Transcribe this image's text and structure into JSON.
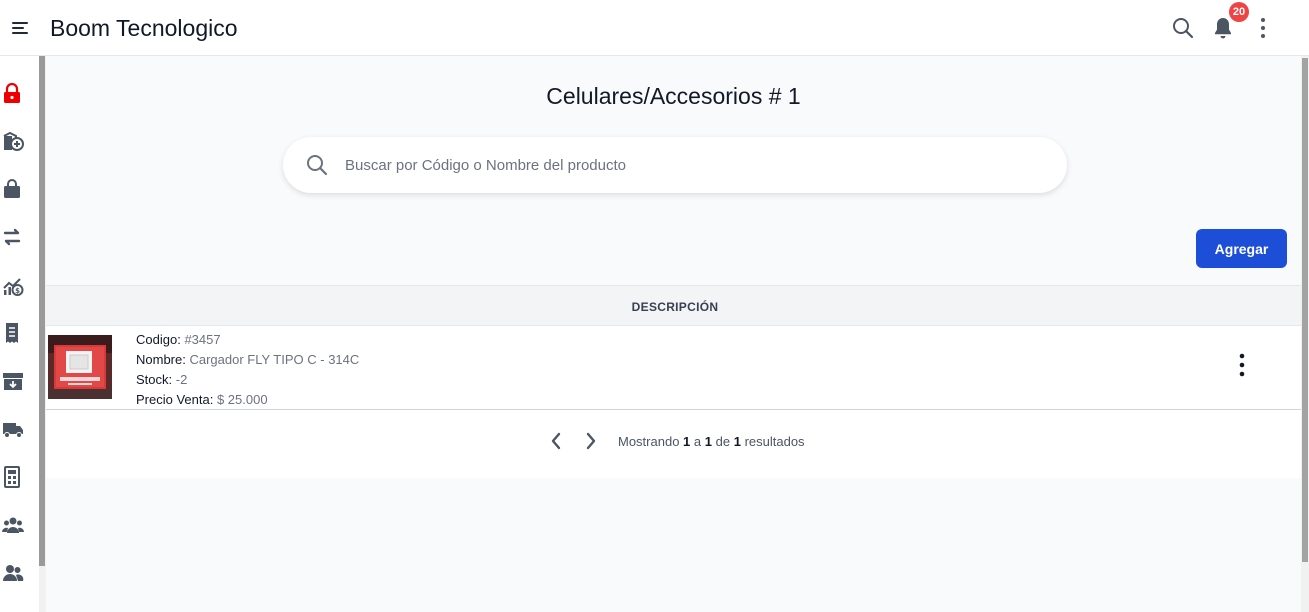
{
  "app": {
    "title": "Boom Tecnologico",
    "notification_count": "20"
  },
  "sidebar": {
    "items": [
      {
        "icon": "lock-icon",
        "active": true
      },
      {
        "icon": "add-to-stock-icon"
      },
      {
        "icon": "shopping-bag-icon"
      },
      {
        "icon": "transfer-arrows-icon"
      },
      {
        "icon": "chart-dollar-icon"
      },
      {
        "icon": "receipt-icon"
      },
      {
        "icon": "archive-box-icon"
      },
      {
        "icon": "truck-icon"
      },
      {
        "icon": "calculator-document-icon"
      },
      {
        "icon": "users-group-icon"
      },
      {
        "icon": "users-icon"
      }
    ]
  },
  "main": {
    "page_title": "Celulares/Accesorios # 1",
    "search_placeholder": "Buscar por Código o Nombre del producto",
    "add_button": "Agregar",
    "table": {
      "column_header": "DESCRIPCIÓN",
      "rows": [
        {
          "codigo_label": "Codigo:",
          "codigo": "#3457",
          "nombre_label": "Nombre:",
          "nombre": "Cargador FLY TIPO C - 314C",
          "stock_label": "Stock:",
          "stock": "-2",
          "precio_label": "Precio Venta:",
          "precio": "$ 25.000"
        }
      ]
    },
    "pagination": {
      "prefix": "Mostrando",
      "from": "1",
      "sep_a": "a",
      "to": "1",
      "sep_de": "de",
      "total": "1",
      "suffix": "resultados"
    }
  },
  "colors": {
    "accent": "#1d4ed8",
    "badge": "#ef4444",
    "active_sidebar_icon": "#ef0000",
    "sidebar_icon": "#4b5563"
  }
}
